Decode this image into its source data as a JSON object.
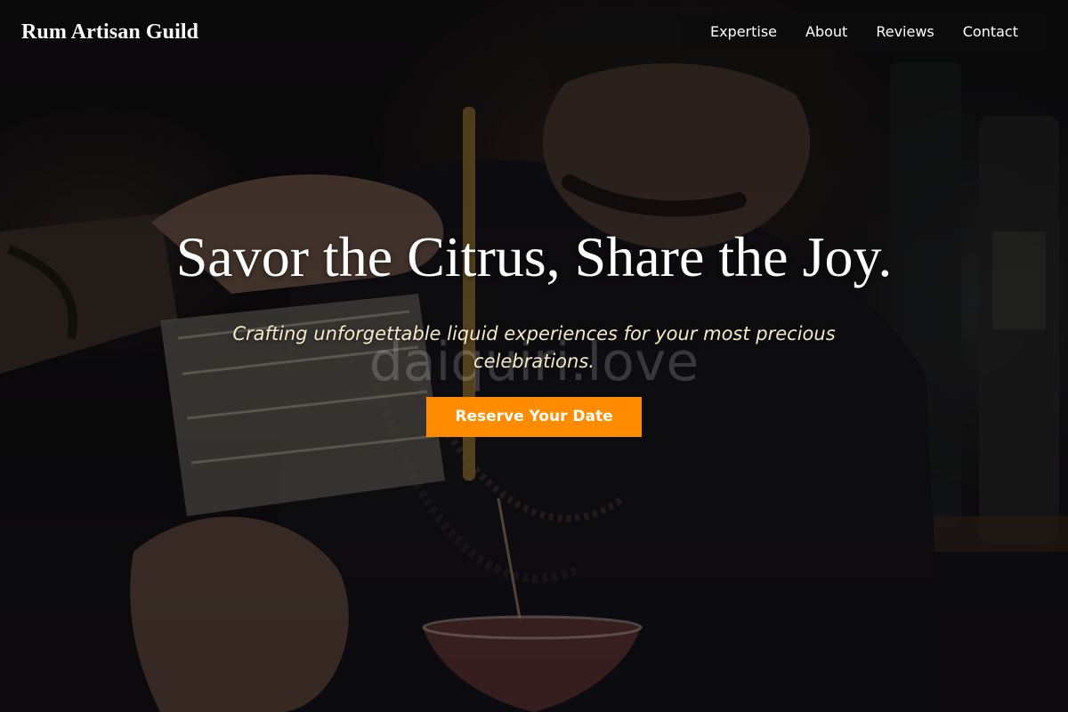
{
  "header": {
    "brand": "Rum Artisan Guild",
    "nav": [
      {
        "label": "Expertise"
      },
      {
        "label": "About"
      },
      {
        "label": "Reviews"
      },
      {
        "label": "Contact"
      }
    ]
  },
  "hero": {
    "title": "Savor the Citrus, Share the Joy.",
    "watermark": "daiquiri.love",
    "subtitle": "Crafting unforgettable liquid experiences for your most precious celebrations.",
    "cta_label": "Reserve Your Date",
    "accent_color": "#ff8c00",
    "subtitle_color": "#f5e9c8",
    "background": "photo of bartender pouring a cocktail into a coupe glass"
  }
}
